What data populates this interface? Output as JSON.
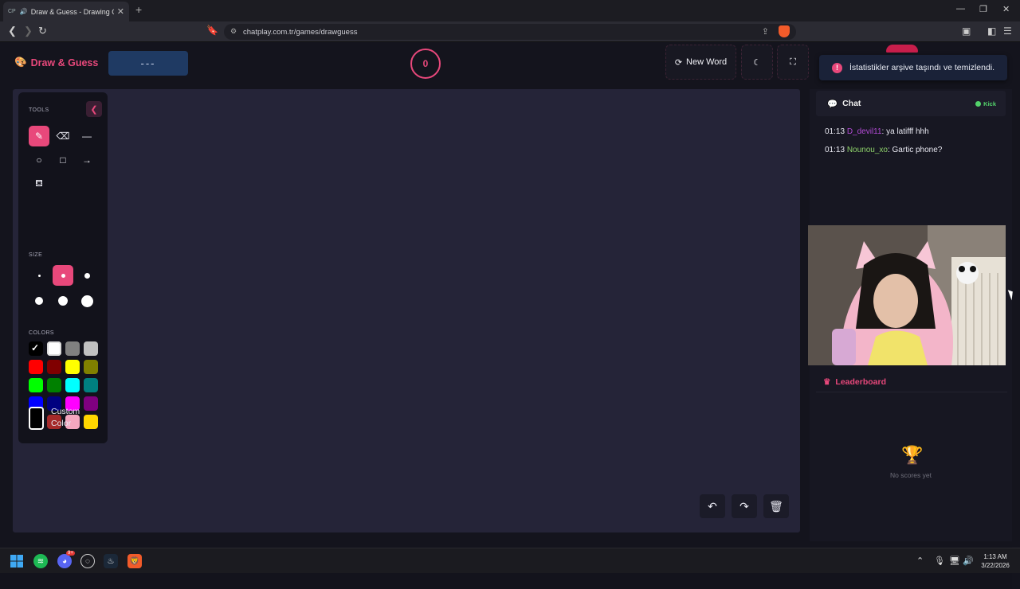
{
  "browser": {
    "tab_title": "Draw & Guess - Drawing Gam",
    "tab_favicon": "CP",
    "url": "chatplay.com.tr/games/drawguess"
  },
  "app": {
    "brand": "Draw & Guess",
    "word_placeholder": "---",
    "timer": "0",
    "new_word_label": "New Word",
    "toast": "İstatistikler arşive taşındı ve temizlendi."
  },
  "toolbox": {
    "tools_label": "TOOLS",
    "size_label": "SIZE",
    "colors_label": "COLORS",
    "custom_color_line1": "Custom",
    "custom_color_line2": "Color",
    "colors": [
      "#000000",
      "#ffffff",
      "#808080",
      "#c0c0c0",
      "#ff0000",
      "#800000",
      "#ffff00",
      "#808000",
      "#00ff00",
      "#008000",
      "#00ffff",
      "#008080",
      "#0000ff",
      "#000080",
      "#ff00ff",
      "#800080",
      "#f5a623",
      "#a52a2a",
      "#f4a7c0",
      "#ffd700"
    ]
  },
  "chat": {
    "title": "Chat",
    "platform": "Kick",
    "messages": [
      {
        "time": "01:13",
        "user": "D_devil11",
        "text": ": ya latifff hhh",
        "color": "#b34bd6"
      },
      {
        "time": "01:13",
        "user": "Nounou_xo",
        "text": ": Gartic phone?",
        "color": "#53d36b"
      }
    ]
  },
  "leaderboard": {
    "title": "Leaderboard",
    "empty": "No scores yet"
  },
  "taskbar": {
    "time": "1:13 AM",
    "date": "3/22/2026",
    "discord_badge": "9+"
  }
}
